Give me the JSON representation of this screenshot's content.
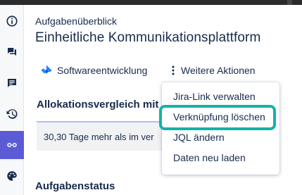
{
  "header": {
    "subtitle": "Aufgabenüberblick",
    "title": "Einheitliche Kommunikationsplattform"
  },
  "actions": {
    "project_label": "Softwareentwicklung",
    "more_label": "Weitere Aktionen"
  },
  "sections": {
    "allocation_title": "Allokationsvergleich mit l",
    "allocation_text": "30,30 Tage mehr als im ver",
    "status_title": "Aufgabenstatus"
  },
  "menu": {
    "items": [
      "Jira-Link verwalten",
      "Verknüpfung löschen",
      "JQL ändern",
      "Daten neu laden"
    ],
    "highlighted_index": 1,
    "highlight_color": "#12b3a8"
  },
  "rail": {
    "icons": [
      "info-icon",
      "chat-icon",
      "comment-icon",
      "history-icon",
      "link-icon",
      "palette-icon"
    ],
    "active": "link-icon",
    "active_color": "#5b5bd6"
  }
}
